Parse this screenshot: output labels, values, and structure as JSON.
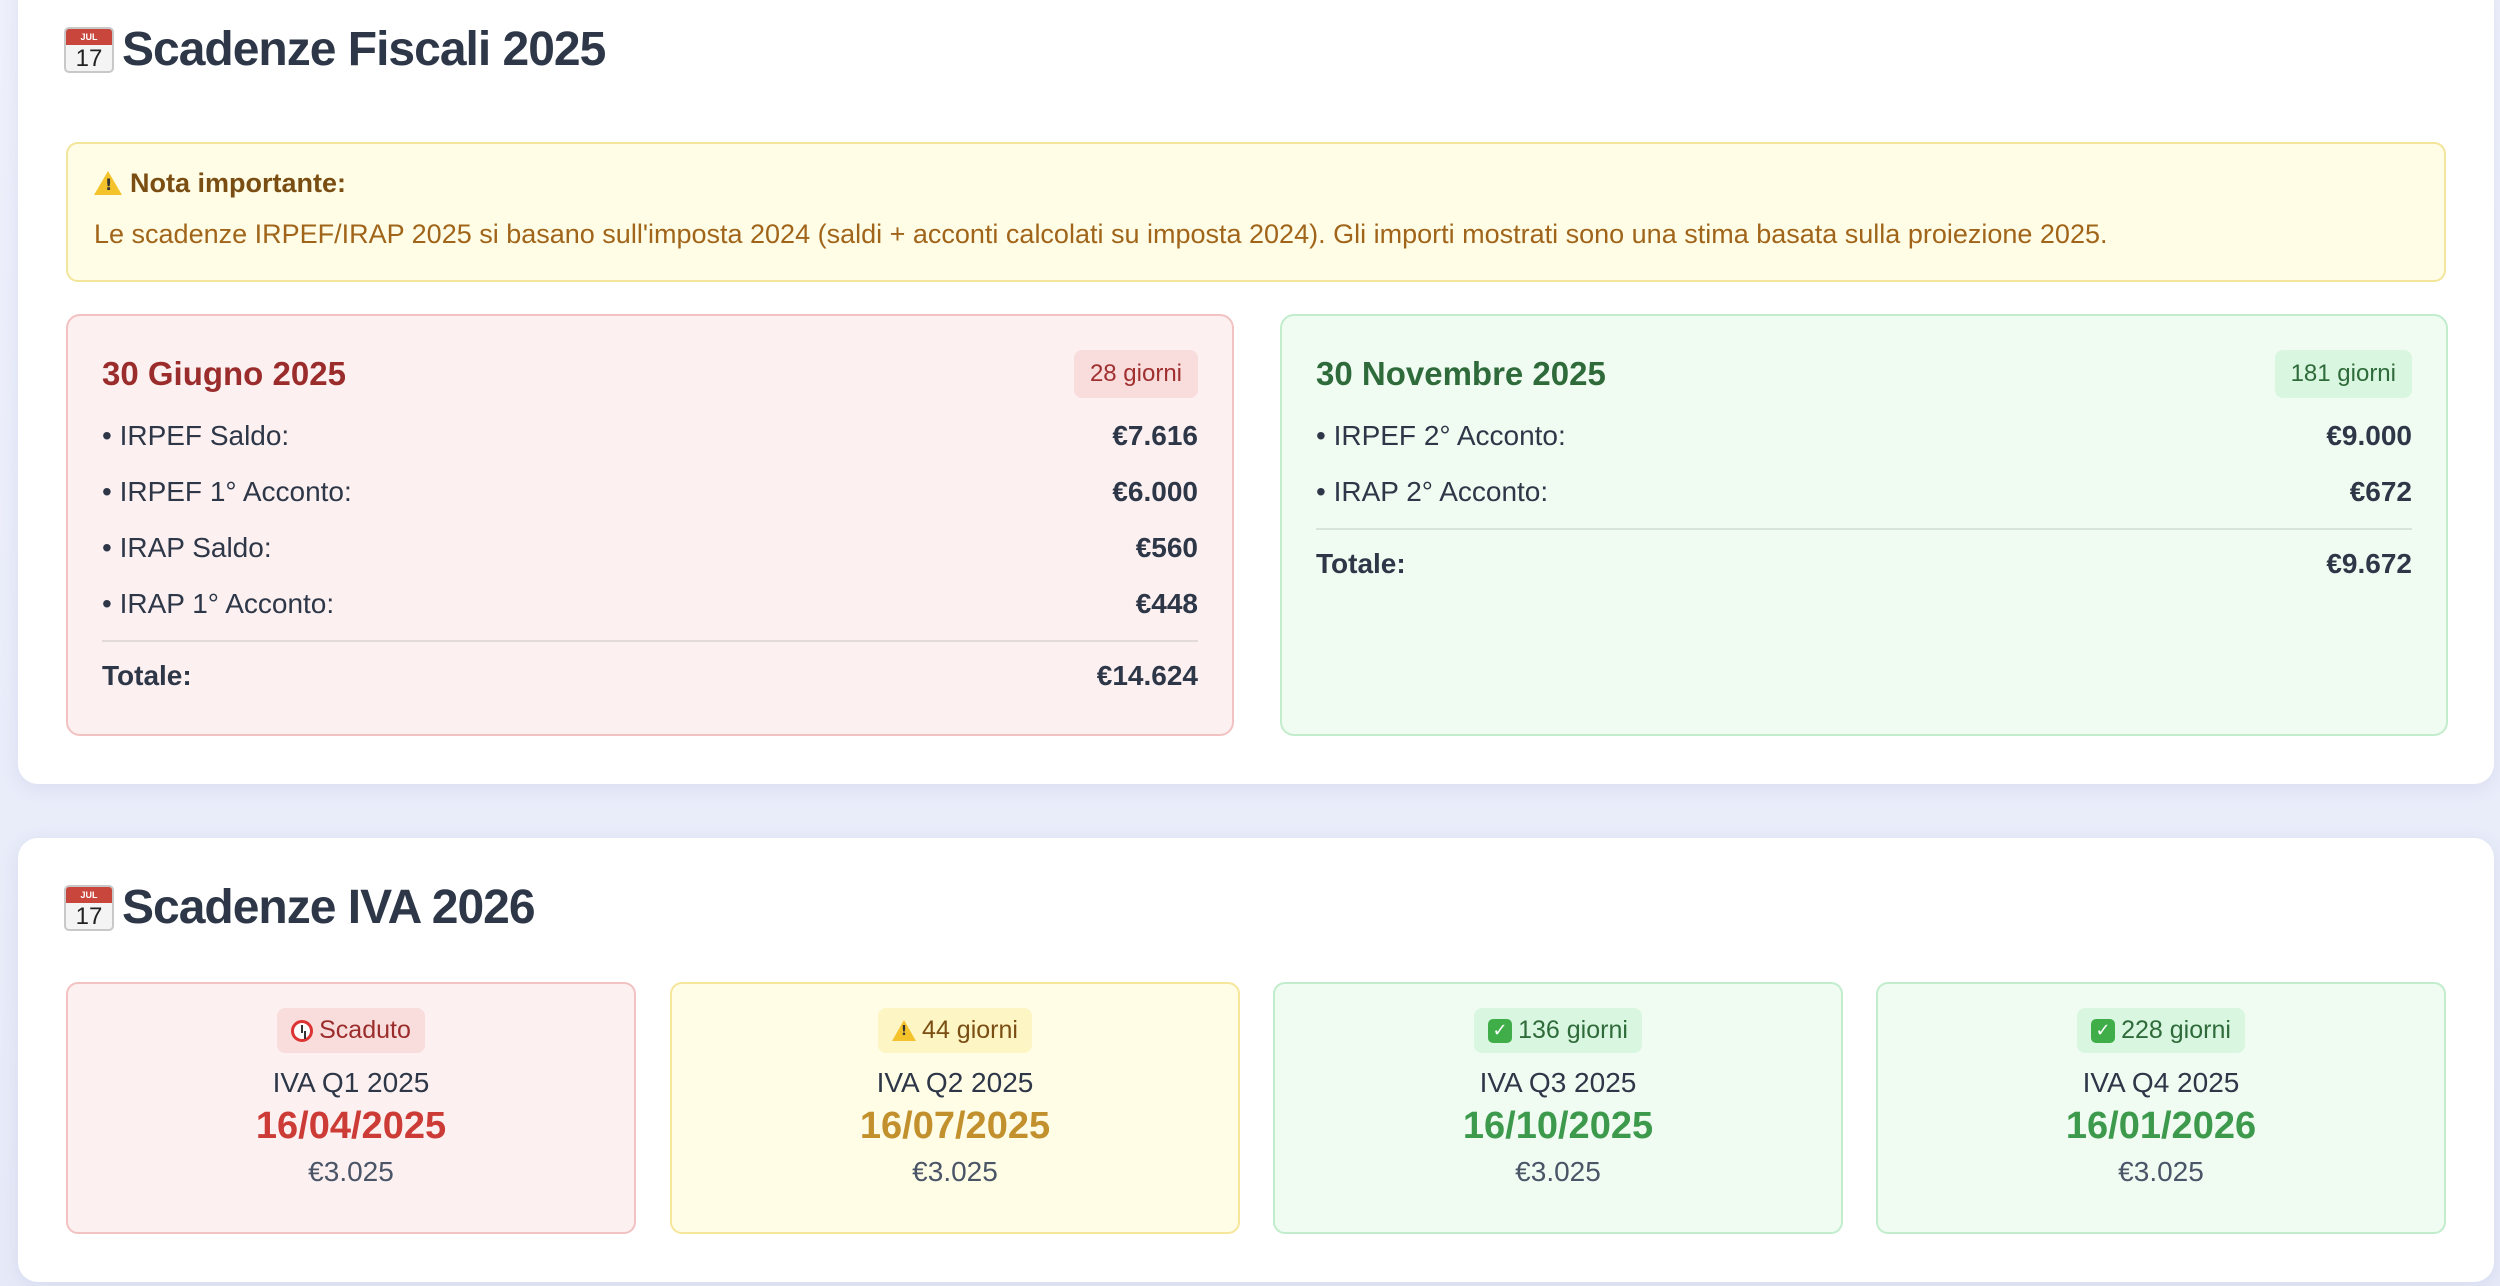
{
  "fiscali": {
    "title": "Scadenze Fiscali 2025",
    "icon": "calendar-icon",
    "calendar_icon_month": "JUL",
    "calendar_icon_day": "17",
    "note": {
      "title": "Nota importante:",
      "text": "Le scadenze IRPEF/IRAP 2025 si basano sull'imposta 2024 (saldi + acconti calcolati su imposta 2024). Gli importi mostrati sono una stima basata sulla proiezione 2025."
    },
    "deadlines": [
      {
        "date": "30 Giugno 2025",
        "days": "28 giorni",
        "items": [
          {
            "label": "• IRPEF Saldo:",
            "amount": "€7.616"
          },
          {
            "label": "• IRPEF 1° Acconto:",
            "amount": "€6.000"
          },
          {
            "label": "• IRAP Saldo:",
            "amount": "€560"
          },
          {
            "label": "• IRAP 1° Acconto:",
            "amount": "€448"
          }
        ],
        "total_label": "Totale:",
        "total": "€14.624",
        "status_color": "#9b2c2c"
      },
      {
        "date": "30 Novembre 2025",
        "days": "181 giorni",
        "items": [
          {
            "label": "• IRPEF 2° Acconto:",
            "amount": "€9.000"
          },
          {
            "label": "• IRAP 2° Acconto:",
            "amount": "€672"
          }
        ],
        "total_label": "Totale:",
        "total": "€9.672",
        "status_color": "#2f6b3a"
      }
    ]
  },
  "iva": {
    "title": "Scadenze IVA 2026",
    "icon": "calendar-icon",
    "calendar_icon_month": "JUL",
    "calendar_icon_day": "17",
    "quarters": [
      {
        "badge": "Scaduto",
        "badge_icon": "alarm-clock-icon",
        "label": "IVA Q1 2025",
        "date": "16/04/2025",
        "amount": "€3.025",
        "color": "#cc3b35"
      },
      {
        "badge": "44 giorni",
        "badge_icon": "warning-icon",
        "label": "IVA Q2 2025",
        "date": "16/07/2025",
        "amount": "€3.025",
        "color": "#c2902d"
      },
      {
        "badge": "136 giorni",
        "badge_icon": "check-icon",
        "label": "IVA Q3 2025",
        "date": "16/10/2025",
        "amount": "€3.025",
        "color": "#3d9a4c"
      },
      {
        "badge": "228 giorni",
        "badge_icon": "check-icon",
        "label": "IVA Q4 2025",
        "date": "16/01/2026",
        "amount": "€3.025",
        "color": "#3d9a4c"
      }
    ]
  }
}
